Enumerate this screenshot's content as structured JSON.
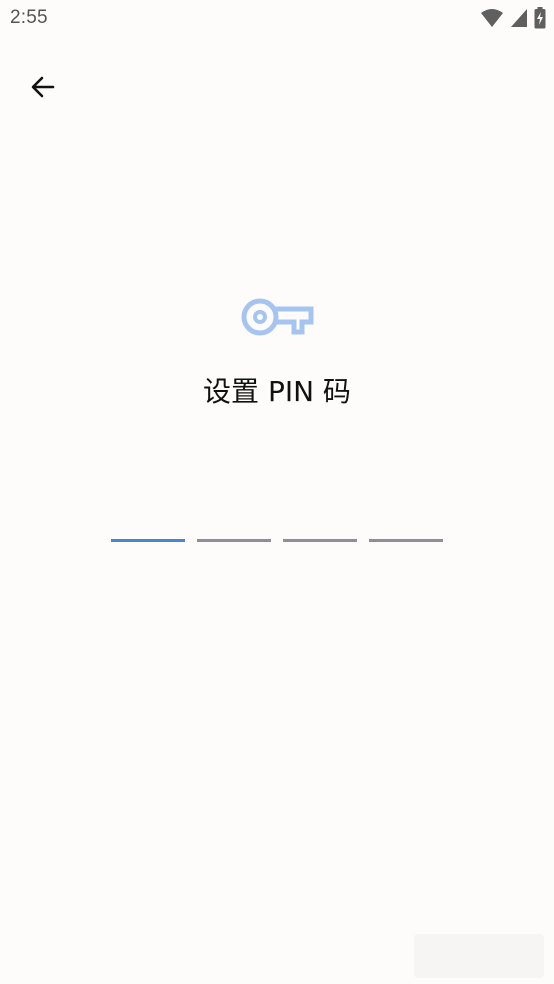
{
  "status_bar": {
    "time": "2:55",
    "icons": [
      "wifi-icon",
      "cellular-signal-icon",
      "battery-charging-icon"
    ]
  },
  "header": {
    "back_icon": "arrow-back-icon"
  },
  "main": {
    "key_icon": "key-icon",
    "title": "设置 PIN 码",
    "pin_slots": [
      {
        "state": "active"
      },
      {
        "state": "empty"
      },
      {
        "state": "empty"
      },
      {
        "state": "empty"
      }
    ]
  },
  "colors": {
    "accent": "#4a86cf",
    "key_icon": "#a6c4f0",
    "inactive_line": "#8f8f99",
    "background": "#fdfcfb"
  }
}
